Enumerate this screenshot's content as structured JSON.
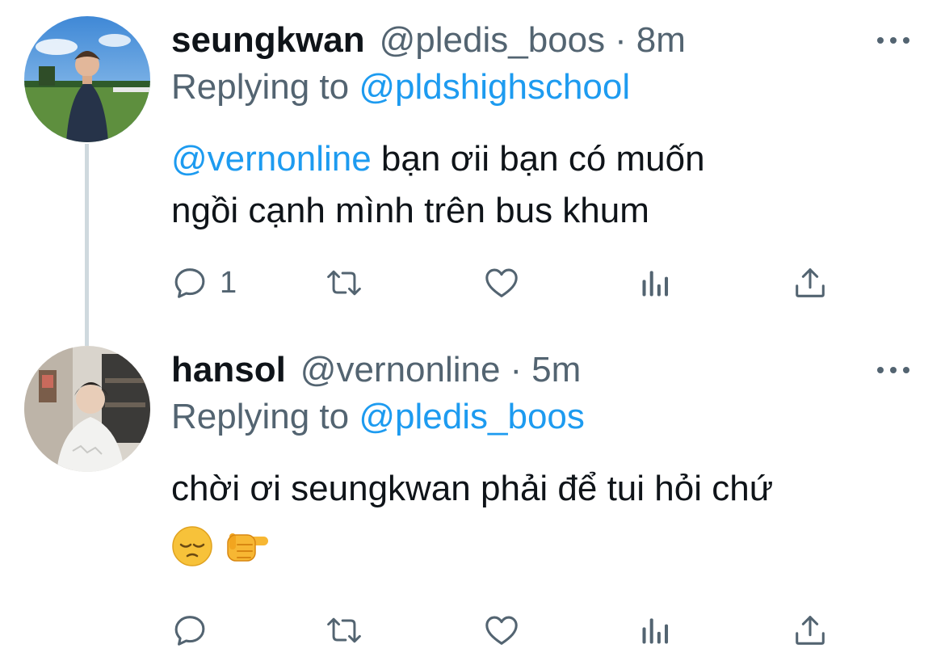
{
  "tweets": [
    {
      "name": "seungkwan",
      "handle": "@pledis_boos",
      "separator": "·",
      "time": "8m",
      "replying_label": "Replying to",
      "replying_to": "@pldshighschool",
      "mention": "@vernonline",
      "text_line1": " bạn ơii bạn có muốn",
      "text_line2": "ngồi cạnh mình trên bus khum",
      "reply_count": "1",
      "avatar_icon": "profile-photo"
    },
    {
      "name": "hansol",
      "handle": "@vernonline",
      "separator": "·",
      "time": "5m",
      "replying_label": "Replying to",
      "replying_to": "@pledis_boos",
      "text_line1": "chời ơi seungkwan phải để tui hỏi chứ",
      "emojis": [
        "pensive-face",
        "backhand-index-pointing-right"
      ],
      "reply_count": "",
      "avatar_icon": "profile-photo"
    }
  ],
  "icons": {
    "reply": "reply-icon",
    "retweet": "retweet-icon",
    "like": "heart-icon",
    "analytics": "analytics-icon",
    "share": "share-icon",
    "more": "more-icon"
  },
  "colors": {
    "link": "#1d9bf0",
    "secondary": "#536471",
    "primary": "#0f1419",
    "thread_line": "#cfd9de"
  }
}
